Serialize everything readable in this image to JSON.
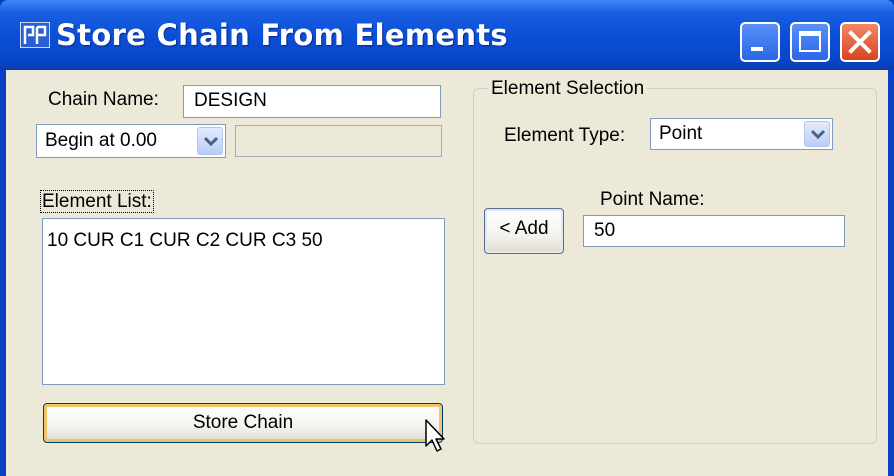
{
  "window": {
    "title": "Store Chain From Elements",
    "title_color": "#ffffff",
    "titlebar_color": "#0b4fd8",
    "client_color": "#ece9d8"
  },
  "titlebar_buttons": {
    "minimize_icon": "minimize-icon",
    "maximize_icon": "maximize-icon",
    "close_icon": "close-icon",
    "close_color": "#d8441e"
  },
  "chain": {
    "name_label": "Chain Name:",
    "name_value": "DESIGN",
    "begin_select": "Begin at 0.00",
    "begin_value": ""
  },
  "element_list": {
    "label": "Element List:",
    "items": "10 CUR C1 CUR C2 CUR C3 50"
  },
  "store_button": {
    "label": "Store Chain"
  },
  "element_selection": {
    "group_title": "Element Selection",
    "type_label": "Element Type:",
    "type_value": "Point",
    "add_label": "< Add",
    "point_name_label": "Point Name:",
    "point_name_value": "50"
  }
}
